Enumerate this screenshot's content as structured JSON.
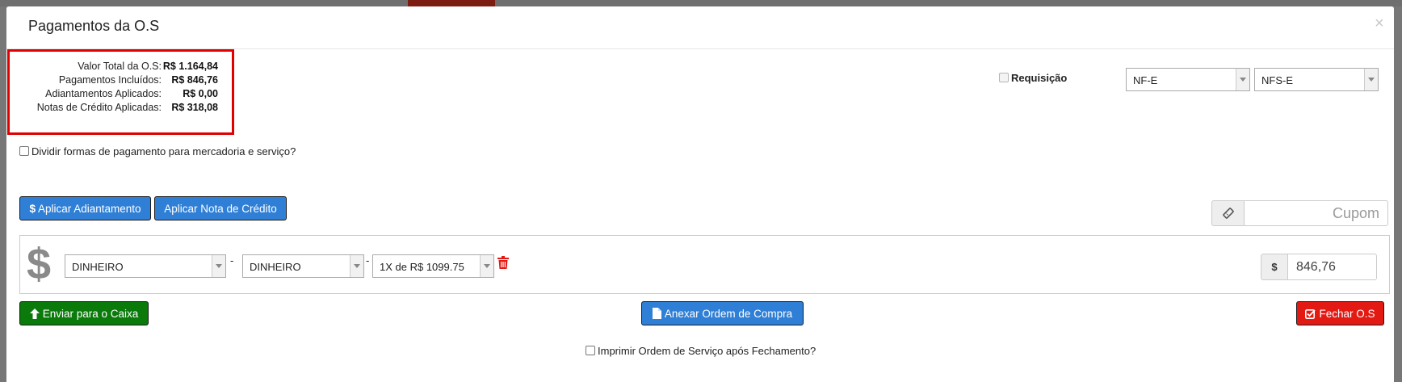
{
  "modal": {
    "title": "Pagamentos da O.S",
    "close_glyph": "×"
  },
  "summary": [
    {
      "label": "Valor Total da O.S:",
      "value": "R$ 1.164,84"
    },
    {
      "label": "Pagamentos Incluídos:",
      "value": "R$ 846,76"
    },
    {
      "label": "Adiantamentos Aplicados:",
      "value": "R$ 0,00"
    },
    {
      "label": "Notas de Crédito Aplicadas:",
      "value": "R$ 318,08"
    }
  ],
  "divide_checkbox": {
    "label": "Dividir formas de pagamento para mercadoria e serviço?",
    "checked": false
  },
  "requisicao": {
    "label": "Requisição",
    "checked": false,
    "disabled": true
  },
  "invoice_selects": {
    "nf": "NF-E",
    "nfs": "NFS-E"
  },
  "actions": {
    "apply_advance": "Aplicar Adiantamento",
    "apply_advance_icon": "$",
    "apply_credit_note": "Aplicar Nota de Crédito"
  },
  "coupon": {
    "placeholder": "Cupom",
    "icon": "ticket-icon"
  },
  "payment": {
    "icon_glyph": "$",
    "method": "DINHEIRO",
    "submethod": "DINHEIRO",
    "installments": "1X de R$ 1099.75",
    "separator": "-",
    "currency_addon": "$",
    "amount": "846,76"
  },
  "footer": {
    "send_to_cashier": "Enviar para o Caixa",
    "attach_purchase_order": "Anexar Ordem de Compra",
    "close_os": "Fechar O.S"
  },
  "print_checkbox": {
    "label": "Imprimir Ordem de Serviço após Fechamento?",
    "checked": false
  },
  "colors": {
    "blue": "#2f7fd6",
    "green": "#0a7a0a",
    "red": "#e31a14",
    "highlight_border": "#e00000"
  }
}
